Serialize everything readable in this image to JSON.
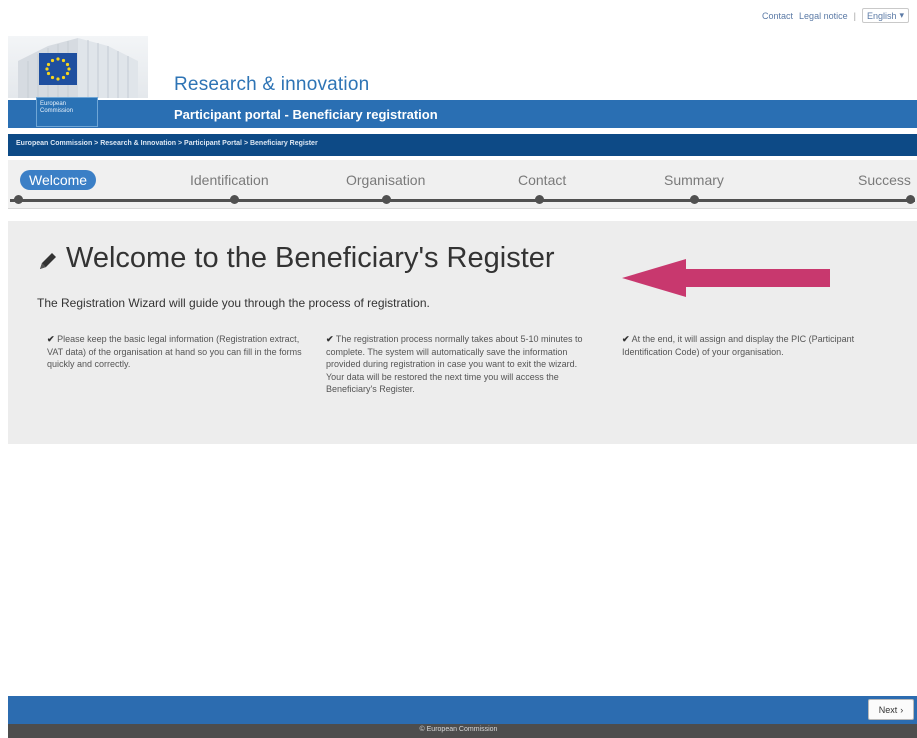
{
  "top": {
    "contact": "Contact",
    "legal": "Legal notice",
    "separator": "|",
    "language": "English"
  },
  "header": {
    "site_title": "Research & innovation",
    "ec_line1": "European",
    "ec_line2": "Commission",
    "bar_title": "Participant portal - Beneficiary registration",
    "breadcrumb": "European Commission > Research & Innovation > Participant Portal > Beneficiary Register"
  },
  "steps": [
    {
      "label": "Welcome",
      "active": true
    },
    {
      "label": "Identification",
      "active": false
    },
    {
      "label": "Organisation",
      "active": false
    },
    {
      "label": "Contact",
      "active": false
    },
    {
      "label": "Summary",
      "active": false
    },
    {
      "label": "Success",
      "active": false
    }
  ],
  "main": {
    "headline": "Welcome to the Beneficiary's Register",
    "intro": "The Registration Wizard will guide you through the process of registration.",
    "columns": [
      "Please keep the basic legal information (Registration extract, VAT data) of the organisation at hand so you can fill in the forms quickly and correctly.",
      "The registration process normally takes about 5-10 minutes to complete. The system will automatically save the information provided during registration in case you want to exit the wizard. Your data will be restored the next time you will access the Beneficiary's Register.",
      "At the end, it will assign and display the PIC (Participant Identification Code) of your organisation."
    ]
  },
  "footer": {
    "next": "Next",
    "copyright": "© European Commission"
  },
  "colors": {
    "brand_blue": "#2a6fb3",
    "dark_blue": "#0d4a86",
    "arrow": "#c8386e"
  },
  "icons": {
    "pencil": "pencil-icon",
    "check": "check-icon",
    "arrow": "arrow-left-icon"
  }
}
